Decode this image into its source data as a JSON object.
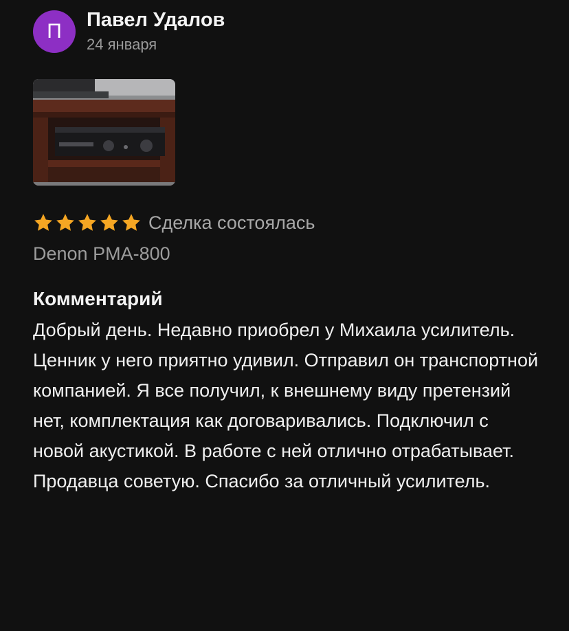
{
  "author": {
    "initial": "П",
    "name": "Павел Удалов",
    "date": "24 января",
    "avatar_color": "#8d2fc4"
  },
  "photo": {
    "icon": "photo-thumbnail"
  },
  "rating": {
    "stars": 5,
    "max": 5,
    "star_color": "#f5a623",
    "status": "Сделка состоялась"
  },
  "product": {
    "name": "Denon PMA-800"
  },
  "comment": {
    "title": "Комментарий",
    "text": "Добрый день. Недавно приобрел у Михаила усилитель. Ценник у него приятно удивил. Отправил он транспортной компанией. Я все получил, к внешнему виду претензий нет, комплектация как договаривались. Подключил с новой акустикой. В работе с ней отлично отрабатывает.\nПродавца советую. Спасибо за отличный усилитель."
  }
}
